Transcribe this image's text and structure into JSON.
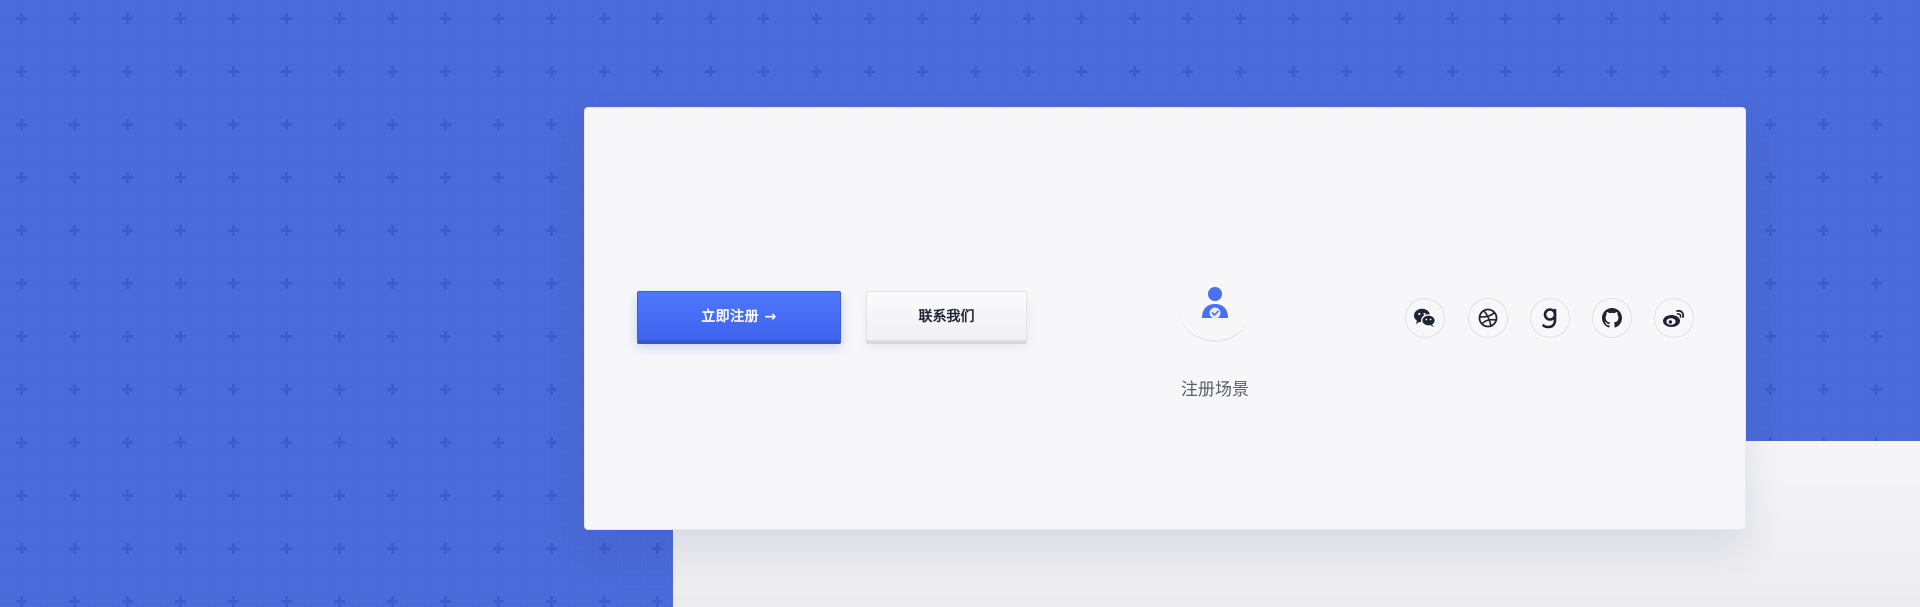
{
  "cta": {
    "register_label": "立即注册 →",
    "contact_label": "联系我们"
  },
  "scene": {
    "icon": "user-verified-icon",
    "label": "注册场景"
  },
  "social": {
    "items": [
      {
        "icon": "wechat-icon"
      },
      {
        "icon": "dribbble-icon"
      },
      {
        "icon": "g-logo-icon"
      },
      {
        "icon": "github-icon"
      },
      {
        "icon": "weibo-icon"
      }
    ]
  },
  "colors": {
    "background_blue": "#4a6ad9",
    "primary_button": "#4a6ff5",
    "card": "#f7f7fa",
    "icon_dark": "#1f2433",
    "icon_accent": "#4a6ff5"
  }
}
